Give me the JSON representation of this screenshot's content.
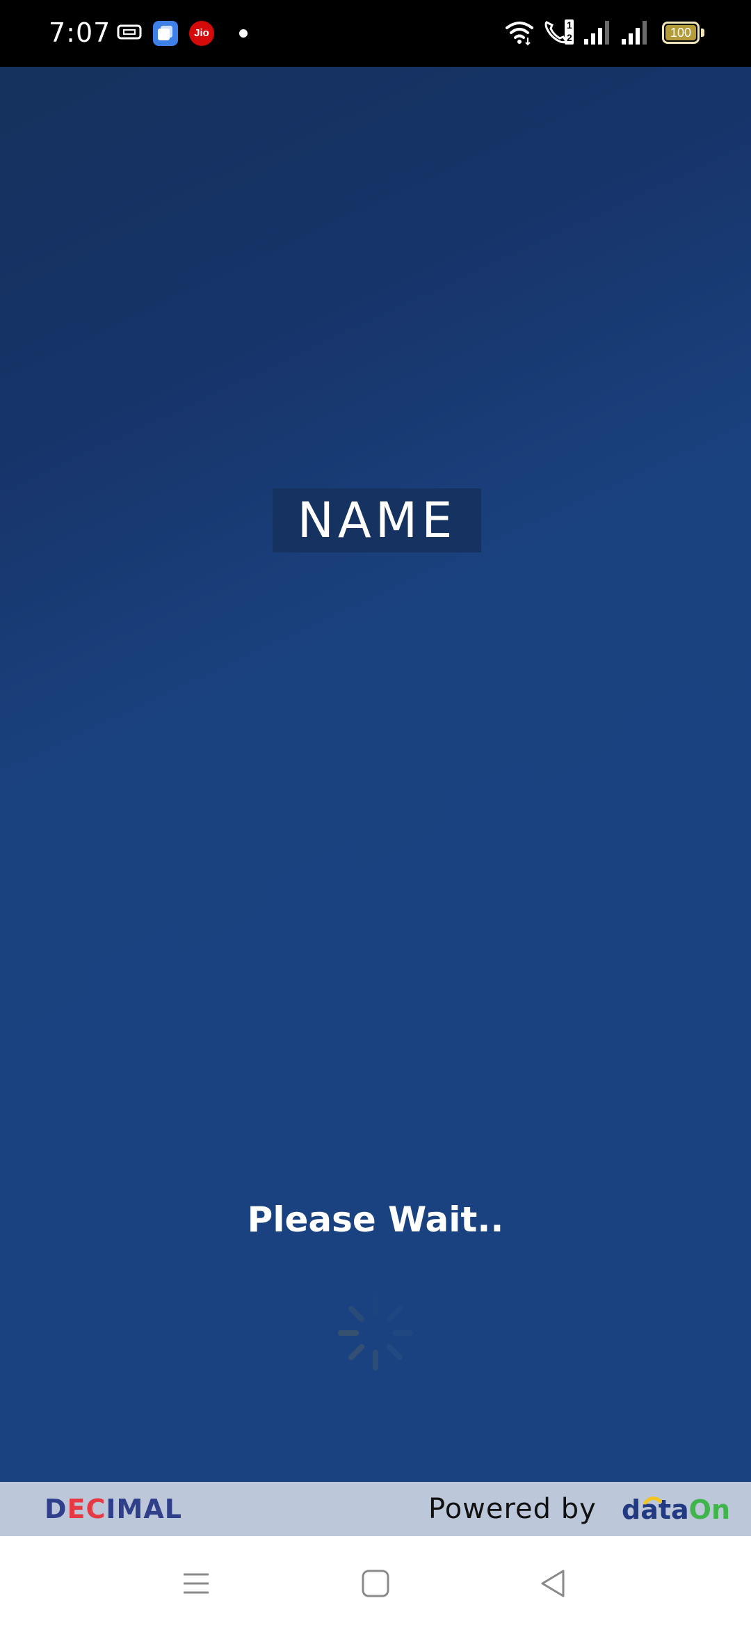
{
  "status_bar": {
    "time": "7:07",
    "battery": "100",
    "icons": [
      "sim-card-icon",
      "app-stack-icon",
      "jio-icon",
      "notification-dot-icon",
      "wifi-icon",
      "wifi-calling-icon",
      "signal-icon",
      "signal-icon",
      "battery-icon"
    ],
    "jio_label": "Jio",
    "call_badge_top": "1",
    "call_badge_bottom": "2"
  },
  "splash": {
    "name_label": "NAME",
    "wait_label": "Please Wait..",
    "spinner_icon": "loading-spinner-icon"
  },
  "footer": {
    "brand_left_part1": "D",
    "brand_left_part2": "E",
    "brand_left_part3": "C",
    "brand_left_part4": "IMAL",
    "powered_label": "Powered by",
    "brand_right_part1": "data",
    "brand_right_part2": "On"
  },
  "nav": {
    "icons": [
      "menu-icon",
      "home-icon",
      "back-icon"
    ]
  },
  "colors": {
    "background_top": "#15315d",
    "background_bottom": "#1a4180",
    "name_box": "#163260",
    "footer": "#bcc7da",
    "decimal_blue": "#2f3f8a",
    "decimal_red": "#e53a44",
    "dataon_blue": "#213a82",
    "dataon_green": "#3fb54b"
  }
}
